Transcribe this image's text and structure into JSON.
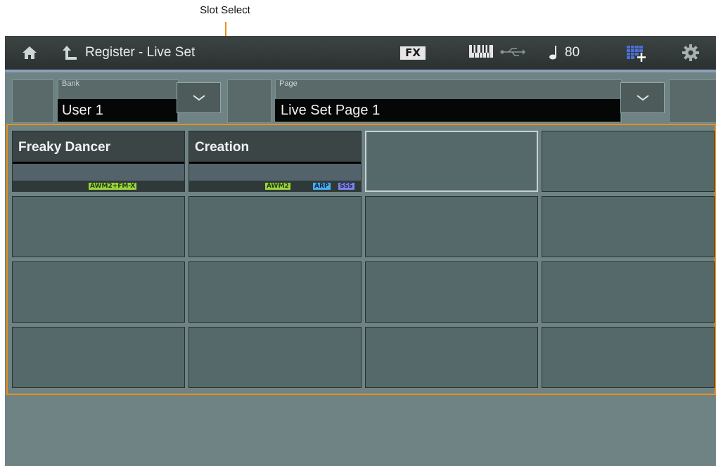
{
  "callout": {
    "label": "Slot Select",
    "color": "#e8901a"
  },
  "topbar": {
    "title": "Register - Live Set",
    "fx_label": "FX",
    "tempo": "80",
    "icons": [
      "home-icon",
      "back-arrow-icon",
      "keyboard-icon",
      "usb-icon",
      "quarter-note-icon",
      "live-set-add-icon",
      "gear-icon"
    ]
  },
  "bank": {
    "label": "Bank",
    "value": "User 1"
  },
  "page": {
    "label": "Page",
    "value": "Live Set Page 1"
  },
  "slots": [
    {
      "name": "Freaky Dancer",
      "badges": [
        "AWM2+FM-X"
      ]
    },
    {
      "name": "Creation",
      "badges": [
        "AWM2",
        "ARP",
        "SSS"
      ]
    },
    {
      "name": "",
      "selected": true
    },
    {
      "name": ""
    }
  ],
  "colors": {
    "accent": "#e8901a",
    "awm": "#9bd43c",
    "fmx": "#2fbf7c",
    "arp": "#4aaef0",
    "sss": "#7b86e8"
  }
}
